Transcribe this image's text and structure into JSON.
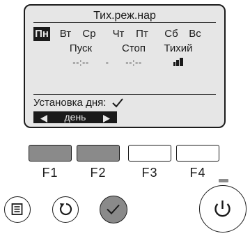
{
  "screen": {
    "title": "Тих.реж.нар",
    "days": [
      {
        "label": "Пн",
        "active": true
      },
      {
        "label": "Вт",
        "active": false
      },
      {
        "label": "Ср",
        "active": false
      },
      {
        "label": "Чт",
        "active": false
      },
      {
        "label": "Пт",
        "active": false
      },
      {
        "label": "Сб",
        "active": false
      },
      {
        "label": "Вс",
        "active": false
      }
    ],
    "columns": {
      "start_header": "Пуск",
      "stop_header": "Стоп",
      "quiet_header": "Тихий",
      "start_value": "--:--",
      "separator": "-",
      "stop_value": "--:--"
    },
    "setting_label": "Установка дня:",
    "day_selector": {
      "label": "день",
      "left_arrow": "◀",
      "right_arrow": "▶"
    }
  },
  "function_keys": [
    {
      "label": "F1",
      "state": "dark"
    },
    {
      "label": "F2",
      "state": "dark"
    },
    {
      "label": "F3",
      "state": "light"
    },
    {
      "label": "F4",
      "state": "light"
    }
  ],
  "icons": {
    "quiet_mode": "fan-level-icon",
    "check": "check-icon",
    "menu_button": "menu-icon",
    "return_button": "return-icon",
    "confirm_button": "check-icon",
    "power_button": "power-icon"
  },
  "colors": {
    "screen_bg": "#e6e6e6",
    "active_day_bg": "#1a1a1a",
    "pressed_key": "#8a8a8a",
    "confirm_button": "#8a8a8a",
    "led": "#8c8c8c"
  }
}
